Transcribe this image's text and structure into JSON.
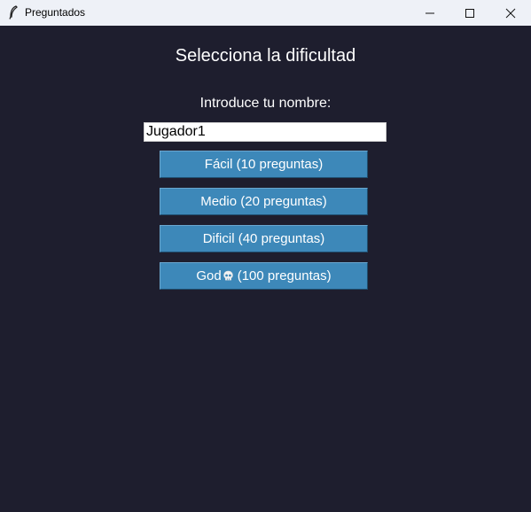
{
  "window": {
    "title": "Preguntados"
  },
  "main": {
    "heading": "Selecciona la dificultad",
    "name_label": "Introduce tu nombre:",
    "name_value": "Jugador1",
    "buttons": [
      {
        "label": "Fácil (10 preguntas)"
      },
      {
        "label": "Medio (20 preguntas)"
      },
      {
        "label": "Dificil (40 preguntas)"
      },
      {
        "prefix": "God",
        "icon": "skull-icon",
        "suffix": "(100 preguntas)"
      }
    ]
  },
  "colors": {
    "background": "#1e1e2e",
    "button": "#3d88b9",
    "titlebar": "#eef1f7",
    "text": "#ffffff"
  }
}
